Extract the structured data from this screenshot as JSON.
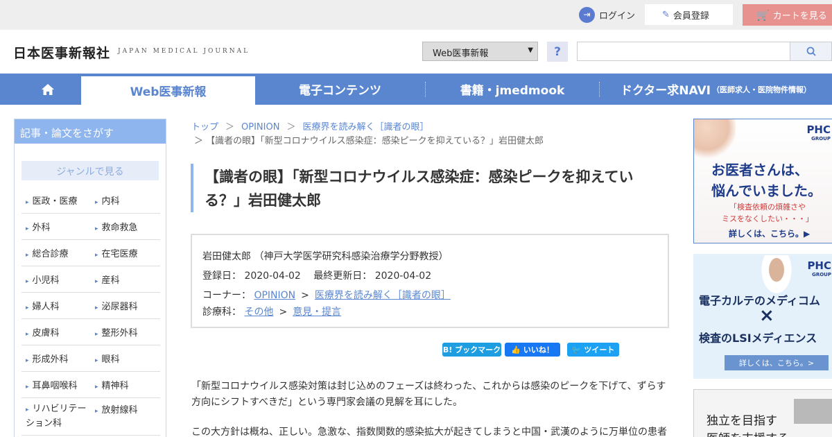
{
  "utility": {
    "login": "ログイン",
    "register": "会員登録",
    "cart": "カートを見る"
  },
  "header": {
    "logo": "日本医事新報社",
    "logo_sub": "JAPAN MEDICAL JOURNAL",
    "select_value": "Web医事新報",
    "help": "?",
    "search_placeholder": ""
  },
  "nav": {
    "items": [
      {
        "label": "Web医事新報",
        "small": ""
      },
      {
        "label": "電子コンテンツ",
        "small": ""
      },
      {
        "label": "書籍・jmedmook",
        "small": ""
      },
      {
        "label": "ドクター求NAVI",
        "small": "（医師求人・医院物件情報）"
      }
    ]
  },
  "sidebar": {
    "title": "記事・論文をさがす",
    "genre_label": "ジャンルで見る",
    "genres": [
      [
        "医政・医療",
        "内科"
      ],
      [
        "外科",
        "救命救急"
      ],
      [
        "総合診療",
        "在宅医療"
      ],
      [
        "小児科",
        "産科"
      ],
      [
        "婦人科",
        "泌尿器科"
      ],
      [
        "皮膚科",
        "整形外科"
      ],
      [
        "形成外科",
        "眼科"
      ],
      [
        "耳鼻咽喉科",
        "精神科"
      ],
      [
        "リハビリテーション科",
        "放射線科"
      ]
    ]
  },
  "breadcrumb": {
    "items": [
      "トップ",
      "OPINION",
      "医療界を読み解く［識者の眼］"
    ],
    "current": "＞ 【識者の眼】「新型コロナウイルス感染症：感染ピークを抑えている？」岩田健太郎"
  },
  "article": {
    "title": "【識者の眼】「新型コロナウイルス感染症：感染ピークを抑えている？」岩田健太郎",
    "author": "岩田健太郎 （神戸大学医学研究科感染治療学分野教授）",
    "posted_label": "登録日：",
    "posted": "2020-04-02",
    "updated_label": "最終更新日：",
    "updated": "2020-04-02",
    "corner_label": "コーナー：",
    "corner_1": "OPINION",
    "corner_2": "医療界を読み解く［識者の眼］",
    "dept_label": "診療科：",
    "dept_1": "その他",
    "dept_2": "意見・提言",
    "p1": "「新型コロナウイルス感染対策は封じ込めのフェーズは終わった、これからは感染のピークを下げて、ずらす方向にシフトすべきだ」という専門家会議の見解を耳にした。",
    "p2": "この大方針は概ね、正しい。急激な、指数関数的感染拡大が起きてしまうと中国・武漢のように万単位の患者"
  },
  "share": {
    "hatena": "B! ブックマーク",
    "like": "いいね！",
    "tweet": "ツイート"
  },
  "ads": {
    "ad1_logo": "PHC",
    "ad1_logo_sub": "GROUP",
    "ad1_head_1": "お医者さんは、",
    "ad1_head_2": "悩んでいました。",
    "ad1_sub_1": "「検査依頼の煩雑さや",
    "ad1_sub_2": "ミスをなくしたい・・・」",
    "ad1_cta": "詳しくは、こちら。▶",
    "ad2_logo": "PHC",
    "ad2_logo_sub": "GROUP",
    "ad2_line1": "電子カルテのメディコム",
    "ad2_x": "×",
    "ad2_line2": "検査のLSIメディエンス",
    "ad2_cta": "詳しくは、こちら。>",
    "ad3_line1": "独立を目指す",
    "ad3_line2": "医師を支援する"
  },
  "colors": {
    "accent": "#5a86d0",
    "nav_bg": "#5a86d0",
    "sidebar_title_bg": "#8eb5ee",
    "cart_bg": "#e7928f",
    "hatena": "#1e9ee0",
    "facebook": "#1877f2",
    "twitter": "#1da1f2"
  }
}
